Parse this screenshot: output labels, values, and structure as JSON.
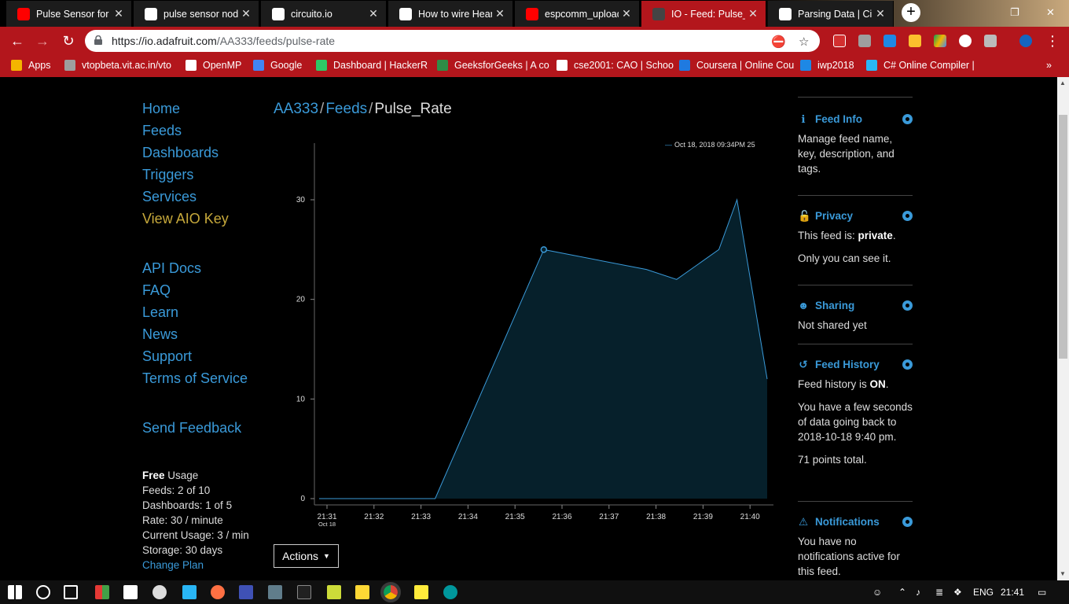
{
  "browser": {
    "tabs": [
      {
        "title": "Pulse Sensor for A",
        "icon": "youtube-icon",
        "color": "#ff0000"
      },
      {
        "title": "pulse sensor node",
        "icon": "google-icon",
        "color": "#ffffff"
      },
      {
        "title": "circuito.io",
        "icon": "chrome-page-icon",
        "color": "#ffffff"
      },
      {
        "title": "How to wire Heart",
        "icon": "chrome-page-icon",
        "color": "#ffffff"
      },
      {
        "title": "espcomm_upload",
        "icon": "youtube-icon",
        "color": "#ff0000"
      },
      {
        "title": "IO - Feed: Pulse_R",
        "icon": "adafruit-io-icon",
        "color": "#444444",
        "active": true
      },
      {
        "title": "Parsing Data | Circ",
        "icon": "document-icon",
        "color": "#ffffff"
      }
    ],
    "url_host": "https://io.adafruit.com",
    "url_path": "/AA333/feeds/pulse-rate",
    "bookmarks": [
      {
        "label": "Apps",
        "icon": "apps-grid-icon"
      },
      {
        "label": "vtopbeta.vit.ac.in/vto",
        "icon": "vit-icon"
      },
      {
        "label": "OpenMP",
        "icon": "document-icon"
      },
      {
        "label": "Google",
        "icon": "google-icon"
      },
      {
        "label": "Dashboard | HackerR",
        "icon": "hackerrank-icon"
      },
      {
        "label": "GeeksforGeeks | A co",
        "icon": "geeksforgeeks-icon"
      },
      {
        "label": "cse2001: CAO | Schoo",
        "icon": "schoology-icon"
      },
      {
        "label": "Coursera | Online Cou",
        "icon": "coursera-icon"
      },
      {
        "label": "iwp2018",
        "icon": "calendar-icon"
      },
      {
        "label": "C# Online Compiler |",
        "icon": "compiler-icon"
      }
    ]
  },
  "sidebar": {
    "nav": [
      "Home",
      "Feeds",
      "Dashboards",
      "Triggers",
      "Services"
    ],
    "aio_key": "View AIO Key",
    "docs": [
      "API Docs",
      "FAQ",
      "Learn",
      "News",
      "Support",
      "Terms of Service"
    ],
    "feedback": "Send Feedback",
    "usage": {
      "plan": "Free",
      "plan_suffix": " Usage",
      "lines": [
        "Feeds: 2 of 10",
        "Dashboards: 1 of 5",
        "Rate: 30 / minute",
        "Current Usage: 3 / min",
        "Storage: 30 days"
      ],
      "change_plan": "Change Plan"
    }
  },
  "breadcrumb": {
    "user": "AA333",
    "section": "Feeds",
    "feed": "Pulse_Rate",
    "sep": "/"
  },
  "chart_data": {
    "type": "area",
    "tooltip": "Oct 18, 2018  09:34PM  25",
    "tooltip_marker": "—",
    "x_ticks": [
      "21:31",
      "21:32",
      "21:33",
      "21:34",
      "21:35",
      "21:36",
      "21:37",
      "21:38",
      "21:39",
      "21:40"
    ],
    "x_first_sub": "Oct 18",
    "y_ticks": [
      0,
      10,
      20,
      30
    ],
    "ylim": [
      0,
      33
    ],
    "xlim": [
      21.02,
      21.77
    ],
    "x": [
      21.0,
      21.04,
      21.1,
      21.16,
      21.2,
      21.22,
      21.4,
      21.57,
      21.62,
      21.69,
      21.72,
      21.77
    ],
    "y": [
      0,
      0,
      0,
      0,
      0,
      0,
      25,
      23,
      22,
      25,
      30,
      12
    ],
    "highlight": {
      "x": 21.4,
      "y": 25
    },
    "fill": "#06202b",
    "stroke": "#3a9ad9"
  },
  "actions_label": "Actions",
  "panels": {
    "info": {
      "title": "Feed Info",
      "text": "Manage feed name, key, description, and tags."
    },
    "privacy": {
      "title": "Privacy",
      "text_pre": "This feed is: ",
      "status": "private",
      "text_post": ".",
      "note": "Only you can see it."
    },
    "sharing": {
      "title": "Sharing",
      "text": "Not shared yet"
    },
    "history": {
      "title": "Feed History",
      "text_pre": "Feed history is ",
      "status": "ON",
      "text_post": ".",
      "detail": "You have a few seconds of data going back to 2018-10-18 9:40 pm.",
      "points": "71 points total."
    },
    "notifications": {
      "title": "Notifications",
      "text": "You have no notifications active for this feed."
    }
  },
  "taskbar": {
    "language": "ENG",
    "time": "21:41"
  },
  "colors": {
    "link": "#3a9ad9",
    "aio_key": "#c7a93b",
    "chrome_red": "#b3161c"
  }
}
